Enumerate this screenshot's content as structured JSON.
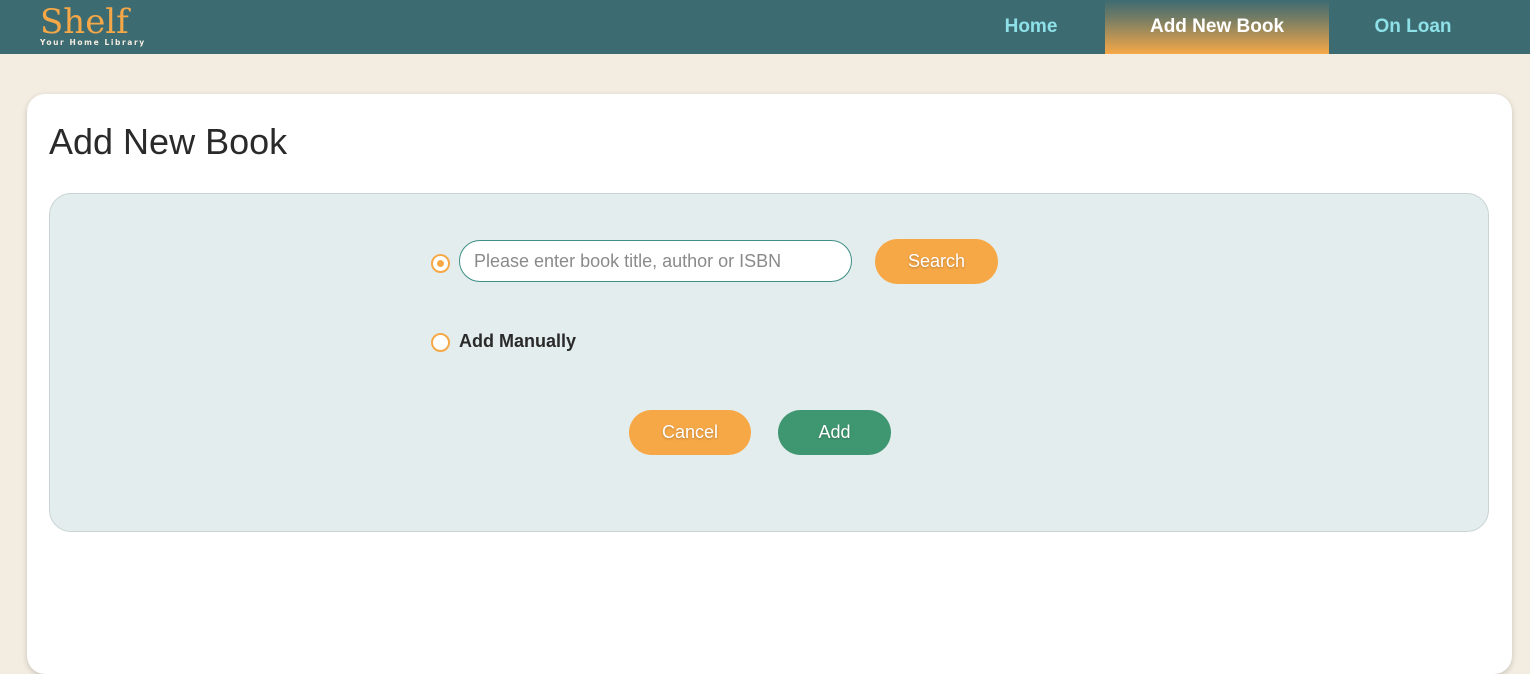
{
  "brand": {
    "logo_text": "Shelf",
    "tagline": "Your Home Library"
  },
  "nav": {
    "home": "Home",
    "add_new_book": "Add New Book",
    "on_loan": "On Loan",
    "active": "Add New Book"
  },
  "page": {
    "title": "Add New Book"
  },
  "form": {
    "search_mode_selected": true,
    "search_placeholder": "Please enter book title, author or ISBN",
    "search_value": "",
    "search_button": "Search",
    "manual_label": "Add Manually",
    "cancel_button": "Cancel",
    "add_button": "Add"
  },
  "colors": {
    "navbar": "#3d6b72",
    "accent_orange": "#f6a847",
    "nav_link": "#8ee1e8",
    "add_green": "#3f9771",
    "page_bg": "#f3ece1",
    "panel_bg": "#e4eded"
  }
}
